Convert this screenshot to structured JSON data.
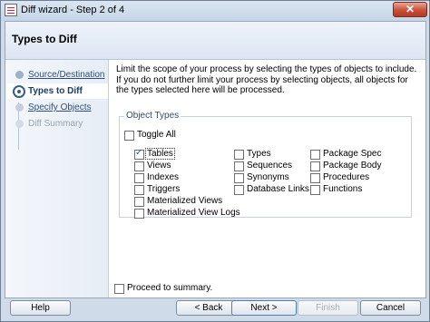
{
  "window": {
    "title": "Diff wizard - Step 2 of 4",
    "close_label": "✕"
  },
  "header": {
    "title": "Types to Diff"
  },
  "steps": [
    {
      "label": "Source/Destination",
      "state": "done"
    },
    {
      "label": "Types to Diff",
      "state": "current"
    },
    {
      "label": "Specify Objects",
      "state": "next"
    },
    {
      "label": "Diff Summary",
      "state": "disabled"
    }
  ],
  "description": "Limit the scope of your process by selecting the types of objects to include.  If you do not further limit your process by selecting objects, all objects for the types selected here will be processed.",
  "object_types": {
    "legend": "Object Types",
    "toggle_all": {
      "label": "Toggle All",
      "checked": false
    },
    "columns": [
      [
        {
          "label": "Tables",
          "checked": true
        },
        {
          "label": "Views",
          "checked": false
        },
        {
          "label": "Indexes",
          "checked": false
        },
        {
          "label": "Triggers",
          "checked": false
        },
        {
          "label": "Materialized Views",
          "checked": false
        },
        {
          "label": "Materialized View Logs",
          "checked": false
        }
      ],
      [
        {
          "label": "Types",
          "checked": false
        },
        {
          "label": "Sequences",
          "checked": false
        },
        {
          "label": "Synonyms",
          "checked": false
        },
        {
          "label": "Database Links",
          "checked": false
        }
      ],
      [
        {
          "label": "Package Spec",
          "checked": false
        },
        {
          "label": "Package Body",
          "checked": false
        },
        {
          "label": "Procedures",
          "checked": false
        },
        {
          "label": "Functions",
          "checked": false
        }
      ]
    ]
  },
  "proceed": {
    "label": "Proceed to summary.",
    "checked": false
  },
  "buttons": {
    "help": "Help",
    "back": "< Back",
    "next": "Next >",
    "finish": "Finish",
    "cancel": "Cancel"
  }
}
